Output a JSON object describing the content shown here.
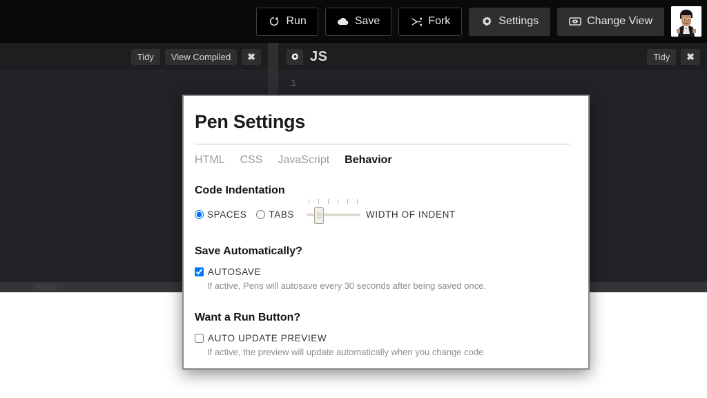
{
  "topbar": {
    "buttons": [
      {
        "label": "Run",
        "icon": "refresh-icon",
        "style": "dark"
      },
      {
        "label": "Save",
        "icon": "cloud-icon",
        "style": "dark"
      },
      {
        "label": "Fork",
        "icon": "fork-icon",
        "style": "dark"
      },
      {
        "label": "Settings",
        "icon": "gear-icon",
        "style": "gray"
      },
      {
        "label": "Change View",
        "icon": "eye-icon",
        "style": "gray"
      }
    ],
    "avatar": "user-avatar"
  },
  "panes": {
    "left": {
      "buttons": [
        "Tidy",
        "View Compiled"
      ],
      "close_label": "✖"
    },
    "right": {
      "settings_icon": "gear-icon",
      "language": "JS",
      "tidy_label": "Tidy",
      "close_label": "✖",
      "first_line_number": "1"
    }
  },
  "modal": {
    "title": "Pen Settings",
    "tabs": [
      {
        "label": "HTML",
        "active": false
      },
      {
        "label": "CSS",
        "active": false
      },
      {
        "label": "JavaScript",
        "active": false
      },
      {
        "label": "Behavior",
        "active": true
      }
    ],
    "indent": {
      "heading": "Code Indentation",
      "spaces_label": "SPACES",
      "tabs_label": "TABS",
      "selected": "SPACES",
      "slider_label": "WIDTH OF INDENT",
      "slider_ticks": 6,
      "slider_value": 2
    },
    "autosave": {
      "heading": "Save Automatically?",
      "checkbox_label": "AUTOSAVE",
      "checked": true,
      "hint": "If active, Pens will autosave every 30 seconds after being saved once."
    },
    "runbutton": {
      "heading": "Want a Run Button?",
      "checkbox_label": "AUTO UPDATE PREVIEW",
      "checked": false,
      "hint": "If active, the preview will update automatically when you change code."
    }
  },
  "colors": {
    "topbar_bg": "#0a0a0a",
    "editor_bg": "#222327",
    "chip_bg": "#2e2f31",
    "modal_border": "#8b8b8b",
    "preview_bg": "#ffffff"
  }
}
